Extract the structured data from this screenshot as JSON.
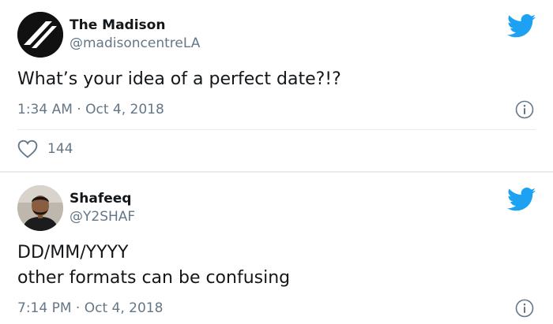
{
  "tweets": [
    {
      "display_name": "The Madison",
      "handle": "@madisoncentreLA",
      "text_lines": [
        "What’s your idea of a perfect date?!?"
      ],
      "time": "1:34 AM",
      "date": "Oct 4, 2018",
      "likes": "144",
      "icons": {
        "avatar": "madison-logo",
        "platform": "twitter-bird-icon",
        "info": "info-icon",
        "like": "heart-icon"
      }
    },
    {
      "display_name": "Shafeeq",
      "handle": "@Y2SHAF",
      "text_lines": [
        "DD/MM/YYYY",
        "other formats can be confusing"
      ],
      "time": "7:14 PM",
      "date": "Oct 4, 2018",
      "icons": {
        "avatar": "user-photo",
        "platform": "twitter-bird-icon",
        "info": "info-icon"
      }
    }
  ],
  "separator": " · ",
  "colors": {
    "brand": "#1da1f2",
    "text": "#14171a",
    "secondary": "#657786",
    "divider": "#e6ecf0"
  }
}
